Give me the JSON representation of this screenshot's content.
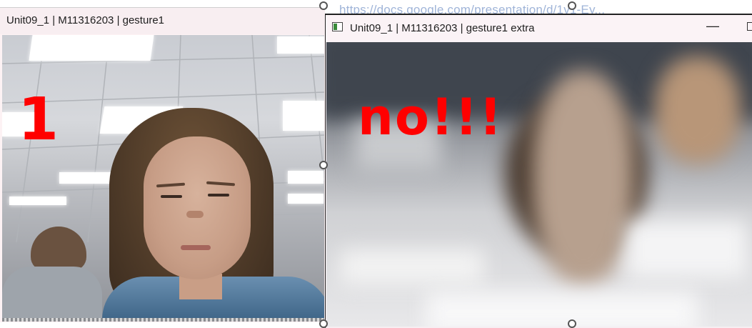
{
  "background": {
    "url_text_prefix": "",
    "url_text": "https://docs.google.com/presentation/d/1v1-Ey..."
  },
  "window1": {
    "title": "Unit09_1 | M11316203 | gesture1",
    "overlay_text": "1",
    "overlay_color": "#ff0000"
  },
  "window2": {
    "title": "Unit09_1 | M11316203 | gesture1 extra",
    "overlay_text": "no!!!",
    "overlay_color": "#ff0000",
    "minimize_glyph": "—"
  },
  "icons": {
    "window2_app_icon": "app-window-icon",
    "minimize": "minimize-icon",
    "maximize": "maximize-icon"
  }
}
